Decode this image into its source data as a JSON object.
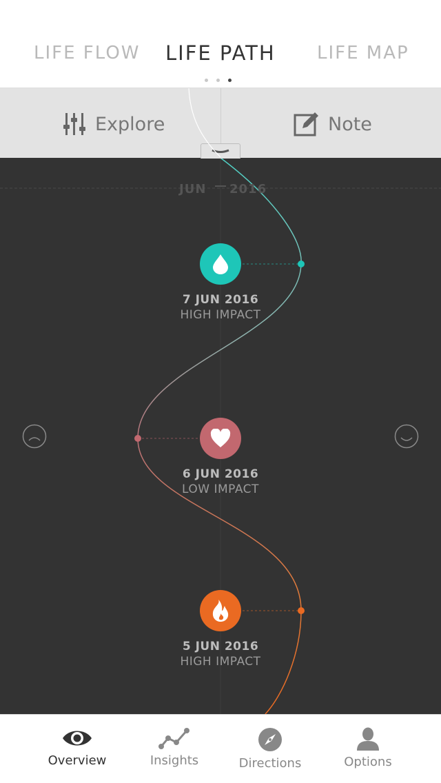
{
  "header": {
    "tabs": [
      {
        "label": "LIFE FLOW"
      },
      {
        "label": "LIFE PATH"
      },
      {
        "label": "LIFE MAP"
      }
    ]
  },
  "toolbar": {
    "explore_label": "Explore",
    "note_label": "Note"
  },
  "timeline": {
    "month_label": "JUN",
    "year_label": "2016",
    "events": [
      {
        "date": "7 JUN 2016",
        "impact": "HIGH IMPACT",
        "icon": "drop-icon",
        "color": "#1ec6b8"
      },
      {
        "date": "6 JUN 2016",
        "impact": "LOW IMPACT",
        "icon": "heart-icon",
        "color": "#c2686f"
      },
      {
        "date": "5 JUN 2016",
        "impact": "HIGH IMPACT",
        "icon": "flame-icon",
        "color": "#ea6a22"
      }
    ],
    "mood_left_icon": "sad-face-icon",
    "mood_right_icon": "happy-face-icon"
  },
  "bottom_nav": {
    "items": [
      {
        "label": "Overview",
        "icon": "eye-icon"
      },
      {
        "label": "Insights",
        "icon": "insights-icon"
      },
      {
        "label": "Directions",
        "icon": "compass-icon"
      },
      {
        "label": "Options",
        "icon": "person-icon"
      }
    ]
  }
}
